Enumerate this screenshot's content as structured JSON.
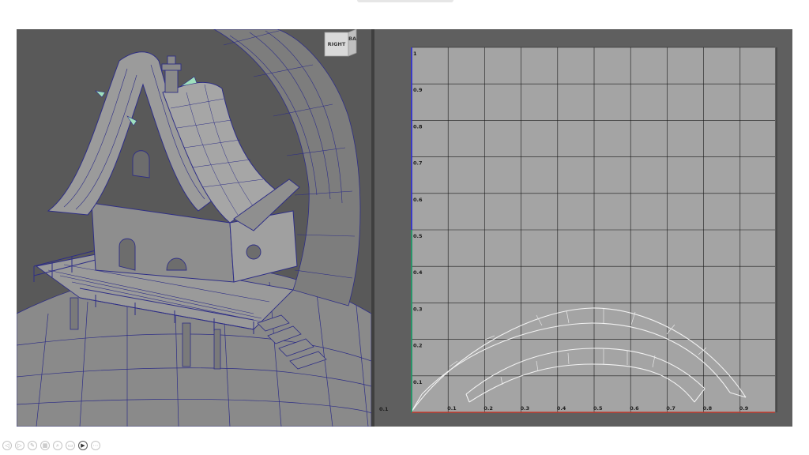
{
  "viewcube": {
    "face_label": "RIGHT",
    "side_label": "BA"
  },
  "uv_editor": {
    "y_ticks": [
      "1",
      "0.9",
      "0.8",
      "0.7",
      "0.6",
      "0.5",
      "0.4",
      "0.3",
      "0.2",
      "0.1"
    ],
    "x_ticks": [
      "0.1",
      "0.2",
      "0.3",
      "0.4",
      "0.5",
      "0.6",
      "0.7",
      "0.8",
      "0.9"
    ],
    "origin_label": "0.1",
    "grid_color": "#1a1a1a",
    "axis_u_color": "#c0392b",
    "axis_v_color": "#2b2bd8",
    "uv_shell_color": "#f2f2f2"
  },
  "mesh_wire_color": "#2e2e86",
  "toolbar": {
    "buttons": [
      {
        "name": "previous-slide-button",
        "icon": "prev-arrow-icon",
        "glyph": "◁"
      },
      {
        "name": "next-slide-button",
        "icon": "next-arrow-icon",
        "glyph": "▷"
      },
      {
        "name": "pen-tool-button",
        "icon": "pen-icon",
        "glyph": "✎"
      },
      {
        "name": "slide-overview-button",
        "icon": "grid-icon",
        "glyph": "▦"
      },
      {
        "name": "zoom-button",
        "icon": "magnifier-icon",
        "glyph": "⌕"
      },
      {
        "name": "subtitles-button",
        "icon": "caption-icon",
        "glyph": "▭"
      },
      {
        "name": "camera-button",
        "icon": "camera-icon",
        "glyph": "▶"
      },
      {
        "name": "more-options-button",
        "icon": "ellipsis-icon",
        "glyph": "⋯"
      }
    ]
  }
}
